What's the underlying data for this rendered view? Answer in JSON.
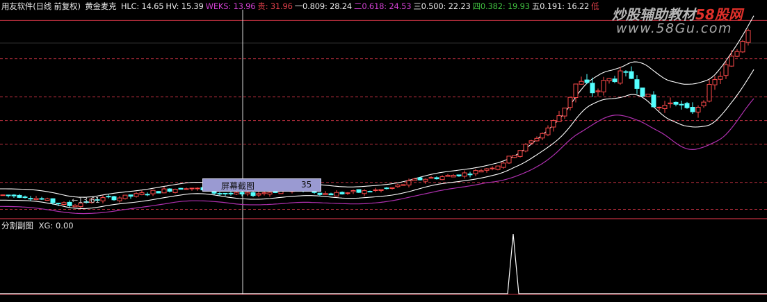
{
  "header": {
    "app": "用友软件(日线 前复权)",
    "indicator": "黄金麦克",
    "items": [
      {
        "text": "HLC: 14.65",
        "color": "#e8e8e8"
      },
      {
        "text": "HV: 15.39",
        "color": "#e8e8e8"
      },
      {
        "text": "WEKS: 13.96",
        "color": "#d040d0"
      },
      {
        "text": "贵: 31.96",
        "color": "#e0404a"
      },
      {
        "text": "一0.809: 28.24",
        "color": "#e8e8e8"
      },
      {
        "text": "二0.618: 24.53",
        "color": "#d040d0"
      },
      {
        "text": "三0.500: 22.23",
        "color": "#e8e8e8"
      },
      {
        "text": "四0.382: 19.93",
        "color": "#40c040"
      },
      {
        "text": "五0.191: 16.22",
        "color": "#e8e8e8"
      },
      {
        "text": "低",
        "color": "#e0404a"
      }
    ]
  },
  "watermark": {
    "line1_a": "炒股辅助教材",
    "line1_b": "58股网",
    "line2": "www.58Gu.com"
  },
  "tooltip": {
    "label": "屏幕截图",
    "value": "35"
  },
  "min_label": "13.61",
  "sub_header": {
    "name": "分割副图",
    "value": "XG: 0.00"
  },
  "colors": {
    "up": "#ff4a4a",
    "down": "#54ffff",
    "band": "#ffffff",
    "weks": "#b030b0",
    "level": "#c03040"
  },
  "chart_data": [
    {
      "type": "candlestick",
      "title": "用友软件(日线 前复权) 黄金麦克",
      "y_range": [
        12.9,
        33.0
      ],
      "levels": [
        {
          "name": "贵",
          "value": 31.96,
          "style": "solid"
        },
        {
          "name": "一0.809",
          "value": 28.24,
          "style": "dashed"
        },
        {
          "name": "二0.618",
          "value": 24.53,
          "style": "dashed"
        },
        {
          "name": "三0.500",
          "value": 22.23,
          "style": "dashed"
        },
        {
          "name": "四0.382",
          "value": 19.93,
          "style": "dashed"
        },
        {
          "name": "五0.191",
          "value": 16.22,
          "style": "dashed"
        },
        {
          "name": "低",
          "value": 13.61,
          "style": "dashed"
        }
      ],
      "price_path": [
        [
          0,
          15.0
        ],
        [
          40,
          14.9
        ],
        [
          70,
          14.4
        ],
        [
          100,
          14.0
        ],
        [
          140,
          14.6
        ],
        [
          180,
          14.8
        ],
        [
          220,
          15.3
        ],
        [
          270,
          15.8
        ],
        [
          300,
          15.3
        ],
        [
          350,
          15.0
        ],
        [
          400,
          15.4
        ],
        [
          440,
          15.5
        ],
        [
          470,
          15.1
        ],
        [
          520,
          15.3
        ],
        [
          560,
          15.6
        ],
        [
          600,
          16.5
        ],
        [
          640,
          16.8
        ],
        [
          680,
          17.2
        ],
        [
          720,
          18.0
        ],
        [
          750,
          19.5
        ],
        [
          780,
          21.0
        ],
        [
          800,
          22.3
        ],
        [
          815,
          24.0
        ],
        [
          830,
          26.0
        ],
        [
          845,
          25.6
        ],
        [
          855,
          24.8
        ],
        [
          870,
          26.0
        ],
        [
          890,
          26.6
        ],
        [
          910,
          26.4
        ],
        [
          925,
          25.0
        ],
        [
          940,
          23.5
        ],
        [
          955,
          23.6
        ],
        [
          970,
          24.5
        ],
        [
          985,
          23.0
        ],
        [
          1000,
          23.4
        ],
        [
          1015,
          24.8
        ],
        [
          1030,
          26.2
        ],
        [
          1045,
          27.5
        ],
        [
          1060,
          29.0
        ],
        [
          1075,
          31.2
        ],
        [
          1090,
          33.0
        ]
      ],
      "series": [
        {
          "name": "HLC",
          "last": 14.65
        },
        {
          "name": "HV",
          "last": 15.39
        },
        {
          "name": "WEKS",
          "last": 13.96
        }
      ],
      "min_marker": 13.61
    },
    {
      "type": "line",
      "title": "分割副图",
      "series": [
        {
          "name": "XG",
          "last": 0.0
        }
      ],
      "spike_value": 1,
      "x_range": [
        0,
        1103
      ]
    }
  ]
}
